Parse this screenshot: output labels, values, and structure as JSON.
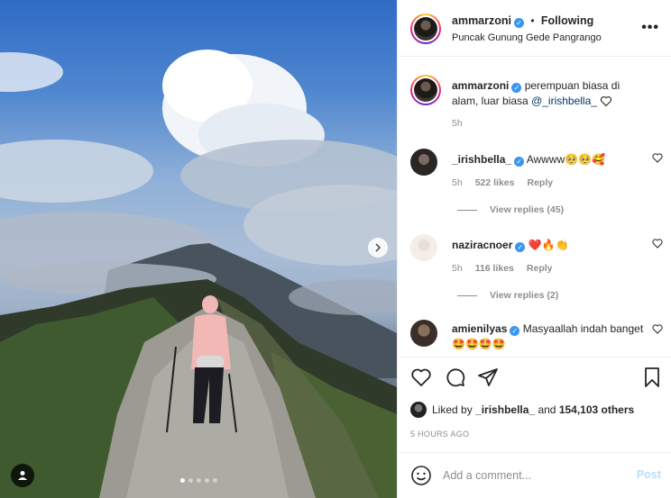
{
  "photo": {
    "carousel": {
      "slides": 5,
      "active_index": 0
    },
    "next_icon": "chevron-right-icon",
    "tag_icon": "person-icon"
  },
  "header": {
    "username": "ammarzoni",
    "separator": "•",
    "follow_status": "Following",
    "location": "Puncak Gunung Gede Pangrango",
    "more_icon": "more-horizontal-icon",
    "more_label": "•••"
  },
  "caption": {
    "username": "ammarzoni",
    "text": "perempuan biasa di alam, luar biasa",
    "mention": "@_irishbella_",
    "time": "5h"
  },
  "comments": [
    {
      "username": "_irishbella_",
      "text": "Awwww🥺🥺🥰",
      "time": "5h",
      "likes": "522 likes",
      "reply": "Reply",
      "view_replies": "View replies (45)"
    },
    {
      "username": "naziracnoer",
      "text": "❤️🔥👏",
      "time": "5h",
      "likes": "116 likes",
      "reply": "Reply",
      "view_replies": "View replies (2)"
    },
    {
      "username": "amienilyas",
      "text": "Masyaallah indah banget 🤩🤩🤩🤩"
    }
  ],
  "actions": {
    "like_icon": "heart-outline-icon",
    "comment_icon": "comment-icon",
    "share_icon": "send-icon",
    "save_icon": "bookmark-icon"
  },
  "likes": {
    "prefix": "Liked by",
    "user": "_irishbella_",
    "joiner": "and",
    "others": "154,103 others"
  },
  "timestamp": "5 HOURS AGO",
  "add_comment": {
    "emoji_icon": "smiley-icon",
    "placeholder": "Add a comment...",
    "post_label": "Post"
  },
  "colors": {
    "verified": "#3897f0",
    "mention": "#00376b",
    "post_disabled": "#b2dffc",
    "muted": "#8e8e8e"
  }
}
